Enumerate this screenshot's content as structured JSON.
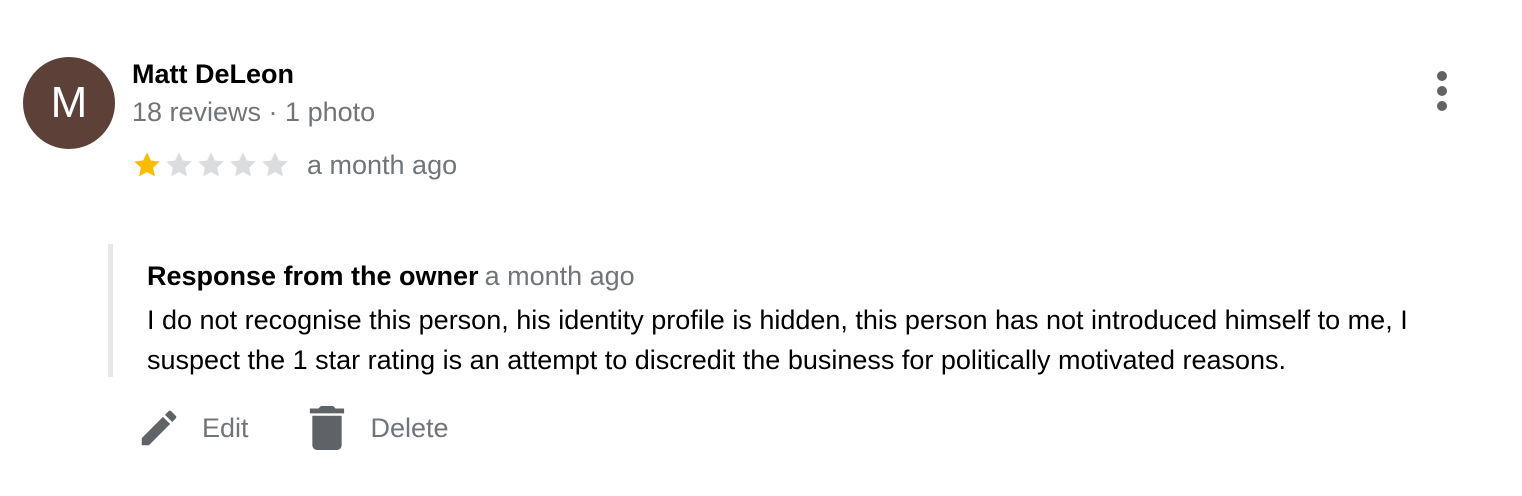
{
  "review": {
    "author": {
      "initial": "M",
      "name": "Matt DeLeon",
      "meta": "18 reviews · 1 photo",
      "avatar_color": "#5d4037"
    },
    "rating": 1,
    "rating_max": 5,
    "date": "a month ago",
    "more_icon": "more-vert-icon"
  },
  "owner_response": {
    "title": "Response from the owner",
    "date": "a month ago",
    "text": "I do not recognise this person, his identity profile is hidden, this person has not introduced himself to me, I suspect the 1 star rating is an attempt to discredit the business for politically motivated reasons."
  },
  "actions": {
    "edit_label": "Edit",
    "edit_icon": "pencil-icon",
    "delete_label": "Delete",
    "delete_icon": "trash-icon"
  },
  "colors": {
    "star_filled": "#fbbc04",
    "star_empty": "#dadce0",
    "secondary_text": "#70757a",
    "icon_gray": "#5f6368",
    "response_border": "#e8e8e8"
  }
}
